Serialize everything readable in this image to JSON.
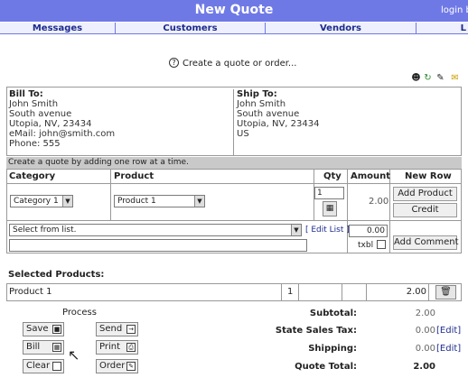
{
  "header": {
    "title": "New Quote",
    "login": "login b"
  },
  "nav": [
    {
      "label": "Messages"
    },
    {
      "label": "Customers"
    },
    {
      "label": "Vendors"
    },
    {
      "label": "L"
    }
  ],
  "help_text": "Create a quote or order...",
  "toolbar_icons": [
    "person-icon",
    "refresh-icon",
    "notes-icon",
    "mail-icon"
  ],
  "bill_to": {
    "heading": "Bill To:",
    "lines": [
      "John Smith",
      "South avenue",
      "Utopia, NV, 23434",
      "eMail: john@smith.com",
      "Phone: 555"
    ]
  },
  "ship_to": {
    "heading": "Ship To:",
    "lines": [
      "John Smith",
      "South avenue",
      "Utopia, NV, 23434",
      "US"
    ]
  },
  "instruction": "Create a quote by adding one row at a time.",
  "editor": {
    "headers": {
      "category": "Category",
      "product": "Product",
      "qty": "Qty",
      "amount": "Amount",
      "new_row": "New Row"
    },
    "category_value": "Category 1",
    "product_value": "Product 1",
    "qty_value": "1",
    "amount_value": "2.00",
    "add_product": "Add Product",
    "credit": "Credit",
    "comment_select": "Select from list.",
    "edit_list": "[ Edit List ]",
    "comment_amount": "0.00",
    "txbl_label": "txbl",
    "add_comment": "Add Comment"
  },
  "selected": {
    "label": "Selected Products:",
    "rows": [
      {
        "name": "Product 1",
        "qty": "1",
        "amount": "2.00"
      }
    ]
  },
  "process": {
    "label": "Process",
    "save": "Save",
    "send": "Send",
    "bill": "Bill",
    "print": "Print",
    "clear": "Clear",
    "order": "Order"
  },
  "totals": {
    "subtotal_label": "Subtotal:",
    "subtotal": "2.00",
    "tax_label": "State Sales Tax:",
    "tax": "0.00",
    "shipping_label": "Shipping:",
    "shipping": "0.00",
    "total_label": "Quote Total:",
    "total": "2.00",
    "edit": "[Edit]"
  }
}
